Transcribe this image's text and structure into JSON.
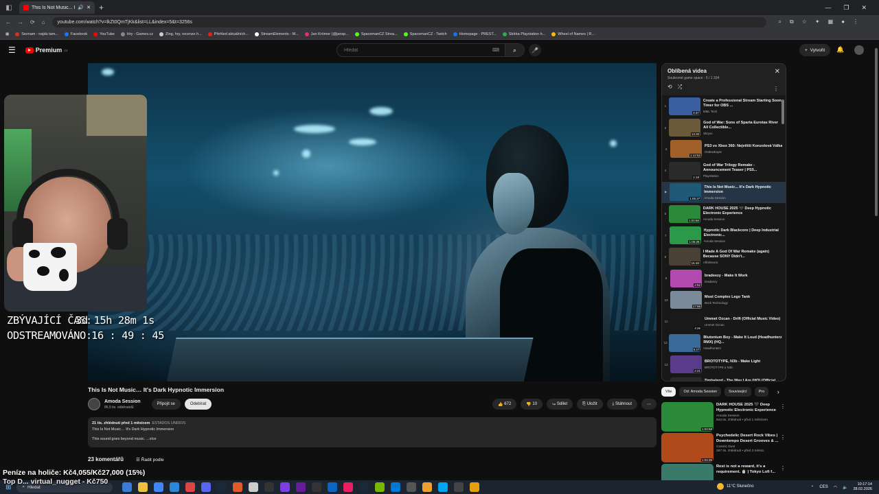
{
  "browser": {
    "tab_title": "This Is Not Music... It's Dark",
    "url": "youtube.com/watch?v=lkZt0QmTjKk&list=LL&index=5&t=3256s"
  },
  "bookmarks": [
    {
      "label": "Seznam - najdu tam...",
      "color": "#d93025"
    },
    {
      "label": "Facebook",
      "color": "#1877f2"
    },
    {
      "label": "YouTube",
      "color": "#ff0000"
    },
    {
      "label": "Hry - Games.cz",
      "color": "#888888"
    },
    {
      "label": "Zing, hry, recenze h...",
      "color": "#cccccc"
    },
    {
      "label": "Přehled aktuálních...",
      "color": "#e2231a"
    },
    {
      "label": "StreamElements - M...",
      "color": "#ffffff"
    },
    {
      "label": "Jan Krömer (@jansp...",
      "color": "#e1306c"
    },
    {
      "label": "SpacemanCZ Strea...",
      "color": "#53fc18"
    },
    {
      "label": "SpacemanCZ - Twitch",
      "color": "#53fc18"
    },
    {
      "label": "Homepage - PREST...",
      "color": "#1a73e8"
    },
    {
      "label": "Sbírka Playstation h...",
      "color": "#34a853"
    },
    {
      "label": "Wheel of Names | R...",
      "color": "#fbbc04"
    }
  ],
  "youtube": {
    "logo_text": "Premium",
    "logo_region": "CZ",
    "search_placeholder": "Hledat",
    "create_label": "Vytvořit"
  },
  "video": {
    "title": "This Is Not Music… It's Dark Hypnotic Immersion",
    "channel": "Amoda Session",
    "subscribers": "86,5 tis. odběratelů",
    "join_label": "Připojit se",
    "subscribe_label": "Odebírat",
    "likes": "672",
    "dislikes": "10",
    "share_label": "Sdílet",
    "save_label": "Uložit",
    "download_label": "Stáhnout",
    "meta": "21 tis. zhlédnutí  před 1 měsícem",
    "location": "ESTADOS UNIDOS",
    "desc_line1": "This Is Not Music… It's Dark Hypnotic Immersion",
    "desc_line2": "This sound goes beyond music.  ...více",
    "comments_count": "23 komentářů",
    "sort_label": "Řadit podle"
  },
  "overlay": {
    "remaining_label": "ZBÝVAJÍCÍ ČAS:",
    "remaining_value": "3d 15h 28m 1s",
    "streamed_label": "ODSTREAMOVÁNO:",
    "streamed_value": "16 : 49 : 45",
    "money": "Peníze na holiče: Kč4,055/Kč27,000 (15%)",
    "top_line": "Top D... virtual_nugget - Kč750"
  },
  "playlist": {
    "title": "Oblíbená videa",
    "subtitle": "Soukromé  game space - 5 / 1 334",
    "items": [
      {
        "index": "1",
        "title": "Create a Professional Stream Starting Soon Timer for OBS ...",
        "channel": "MML Tech",
        "duration": "3:37",
        "color": "#3a5fa0"
      },
      {
        "index": "2",
        "title": "God of War: Sons of Sparta Eurotas River All Collectible...",
        "channel": "Skrysx",
        "duration": "13:30",
        "color": "#6a5a3a"
      },
      {
        "index": "3",
        "title": "PS3 vs Xbox 360: Největší Konzolová Válka",
        "channel": "OstlewExpie",
        "duration": "1:12:52",
        "color": "#a0602a"
      },
      {
        "index": "4",
        "title": "God of War Trilogy Remake - Announcement Teaser | PS5...",
        "channel": "PlayStation",
        "duration": "2:18",
        "color": "#2a2a2a"
      },
      {
        "index": "▶",
        "title": "This Is Not Music... It's Dark Hypnotic Immersion",
        "channel": "Amoda Session",
        "duration": "1:06:37",
        "color": "#1e5a78"
      },
      {
        "index": "6",
        "title": "DARK HOUSE 2025 🖤 Deep Hypnotic Electronic Experience",
        "channel": "Amoda Session",
        "duration": "1:03:58",
        "color": "#2a8a3a"
      },
      {
        "index": "7",
        "title": "Hypnotic Dark Blackcore | Deep Industrial Electronic...",
        "channel": "Amoda Session",
        "duration": "1:05:28",
        "color": "#2a9a4a"
      },
      {
        "index": "8",
        "title": "I Made A God Of War Remake (again) Because SONY Didn't...",
        "channel": "Alfolmeora",
        "duration": "16:49",
        "color": "#4a4035"
      },
      {
        "index": "9",
        "title": "bradeezy - Make It Work",
        "channel": "bradeezy",
        "duration": "2:52",
        "color": "#b04ab0"
      },
      {
        "index": "10",
        "title": "Most Complex Lego Tank",
        "channel": "Brick Technology",
        "duration": "17:56",
        "color": "#7a8a9a"
      },
      {
        "index": "11",
        "title": "Ummet Ozcan - Drift (Official Music Video)",
        "channel": "Ummet Ozcan",
        "duration": "4:26",
        "color": "#1a1a1a"
      },
      {
        "index": "12",
        "title": "Blutonium Boy - Make It Loud (Headhunterz RMX) (HQ...",
        "channel": "Headhunterz",
        "duration": "5:27",
        "color": "#3a6a9a"
      },
      {
        "index": "13",
        "title": "BROTOTYPE, N3b - Make Light",
        "channel": "BROTOTYPE a N3b",
        "duration": "2:21",
        "color": "#5a3a8a"
      },
      {
        "index": "14",
        "title": "Timbaland - The Way I Are (HQ) (Official Video)",
        "channel": "Timbaland",
        "duration": "",
        "color": "#2a2a2a"
      }
    ]
  },
  "chips": [
    "Vše",
    "Od: Amoda Session",
    "Související",
    "Pro"
  ],
  "related": [
    {
      "title": "DARK HOUSE 2025 🖤 Deep Hypnotic Electronic Experience",
      "channel": "Amoda Session",
      "views": "843 tis. zhlédnutí • před 1 měsícem",
      "duration": "1:03:58",
      "color": "#2a8a3a"
    },
    {
      "title": "Psychedelic Desert Rock Vibes | Downtempo Desert Grooves & ...",
      "channel": "Cosmic Dust",
      "views": "287 tis. zhlédnutí • před 3 měsíci",
      "duration": "1:03:35",
      "color": "#b04a1a"
    },
    {
      "title": "Rest is not a reward, it's a requirement. 🍵 | Tokyo Lofi f...",
      "channel": "",
      "views": "",
      "duration": "",
      "color": "#3a7a6a"
    }
  ],
  "taskbar": {
    "search_label": "Hledat",
    "weather": "11°C  Slunečno",
    "lang": "CES",
    "time": "10:17:14",
    "date": "28.02.2026"
  }
}
